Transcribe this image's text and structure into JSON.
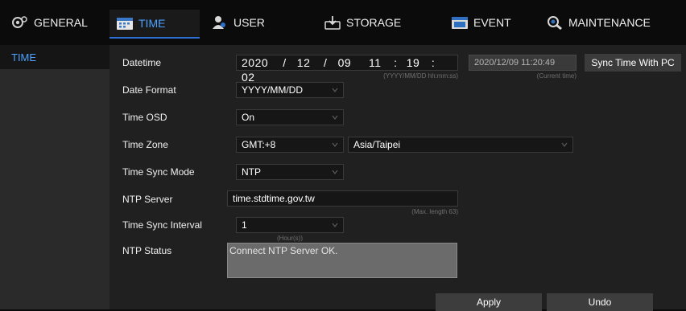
{
  "nav": {
    "tabs": [
      {
        "label": "GENERAL",
        "icon": "general-icon"
      },
      {
        "label": "TIME",
        "icon": "calendar-icon"
      },
      {
        "label": "USER",
        "icon": "user-icon"
      },
      {
        "label": "STORAGE",
        "icon": "storage-icon"
      },
      {
        "label": "EVENT",
        "icon": "event-icon"
      },
      {
        "label": "MAINTENANCE",
        "icon": "maintenance-icon"
      }
    ],
    "active_tab": "TIME"
  },
  "sidebar": {
    "items": [
      {
        "label": "TIME"
      }
    ]
  },
  "form": {
    "datetime": {
      "label": "Datetime",
      "year": "2020",
      "sep1": "/",
      "month": "12",
      "sep2": "/",
      "day": "09",
      "hour": "11",
      "sep3": ":",
      "minute": "19",
      "sep4": ":",
      "second": "02",
      "hint": "(YYYY/MM/DD hh:mm:ss)",
      "current_time": "2020/12/09 11:20:49",
      "current_time_hint": "(Current time)",
      "sync_button": "Sync Time With PC"
    },
    "date_format": {
      "label": "Date Format",
      "value": "YYYY/MM/DD"
    },
    "time_osd": {
      "label": "Time OSD",
      "value": "On"
    },
    "time_zone": {
      "label": "Time Zone",
      "offset": "GMT:+8",
      "region": "Asia/Taipei"
    },
    "time_sync_mode": {
      "label": "Time Sync Mode",
      "value": "NTP"
    },
    "ntp_server": {
      "label": "NTP Server",
      "value": "time.stdtime.gov.tw",
      "hint": "(Max. length 63)"
    },
    "time_sync_interval": {
      "label": "Time Sync Interval",
      "value": "1",
      "hint": "(Hour(s))"
    },
    "ntp_status": {
      "label": "NTP Status",
      "value": "Connect NTP Server OK."
    }
  },
  "actions": {
    "apply": "Apply",
    "undo": "Undo"
  },
  "colors": {
    "accent": "#4da3ff",
    "panel": "#202020",
    "sidebar": "#2a2a2a",
    "button": "#3d3d3d"
  }
}
